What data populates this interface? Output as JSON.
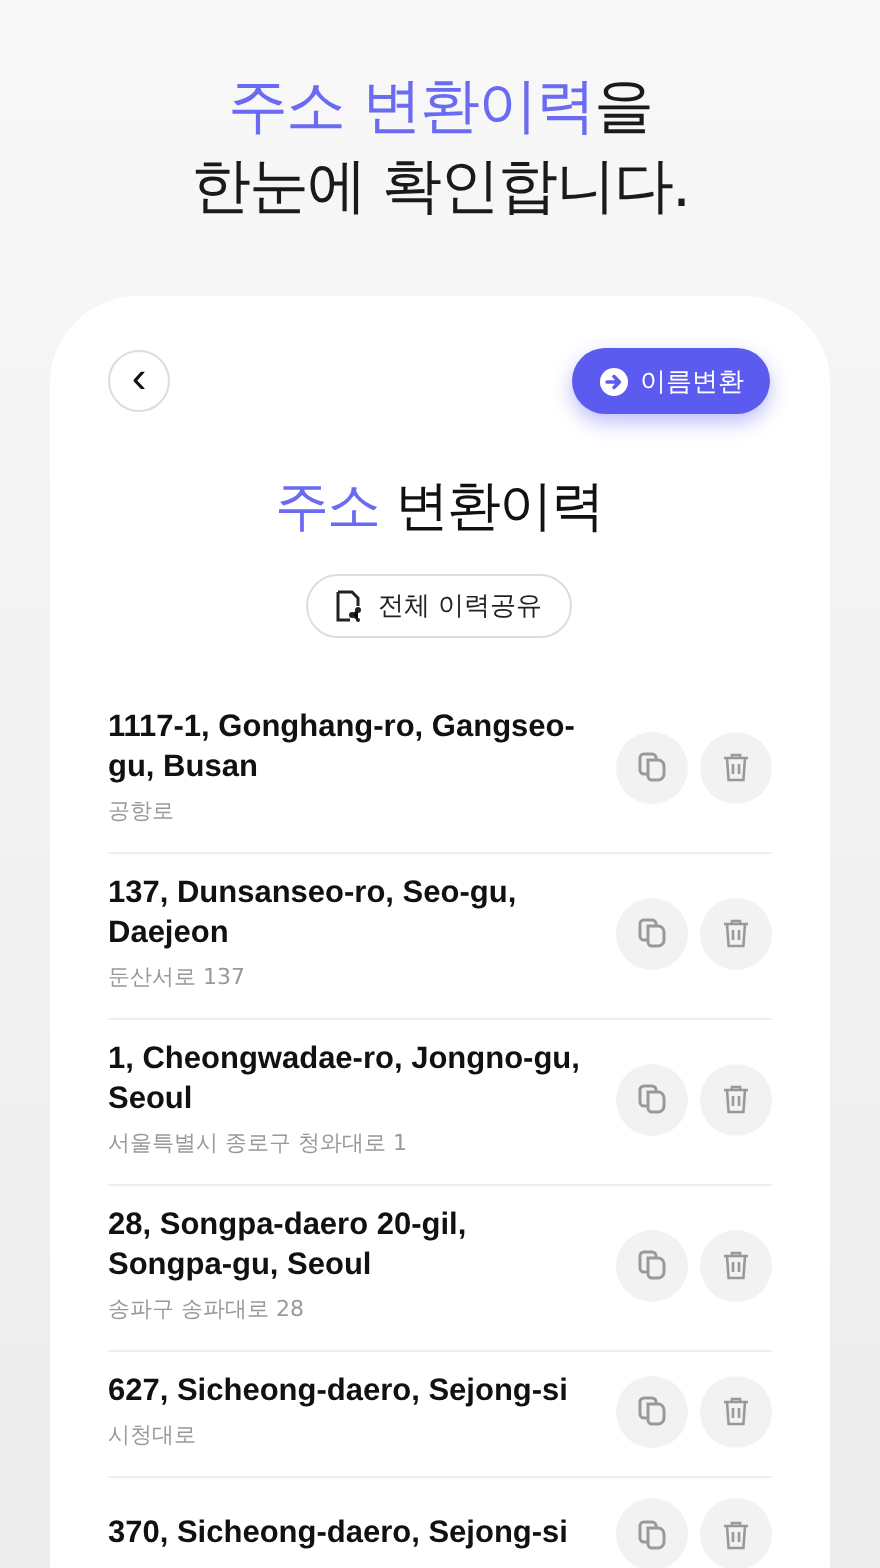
{
  "headline": {
    "accent": "주소 변환이력",
    "rest": "을",
    "line2": "한눈에 확인합니다."
  },
  "header": {
    "back_button": "‹",
    "convert_button": "이름변환"
  },
  "title": {
    "accent": "주소",
    "rest": "변환이력"
  },
  "share_button": "전체 이력공유",
  "history": [
    {
      "address": "1117-1, Gonghang-ro, Gangseo-gu, Busan",
      "korean": "공항로"
    },
    {
      "address": "137, Dunsanseo-ro, Seo-gu, Daejeon",
      "korean": "둔산서로 137"
    },
    {
      "address": "1, Cheongwadae-ro, Jongno-gu, Seoul",
      "korean": "서울특별시 종로구 청와대로 1"
    },
    {
      "address": "28, Songpa-daero 20-gil, Songpa-gu, Seoul",
      "korean": "송파구 송파대로 28"
    },
    {
      "address": "627, Sicheong-daero, Sejong-si",
      "korean": "시청대로"
    },
    {
      "address": "370, Sicheong-daero, Sejong-si"
    }
  ]
}
